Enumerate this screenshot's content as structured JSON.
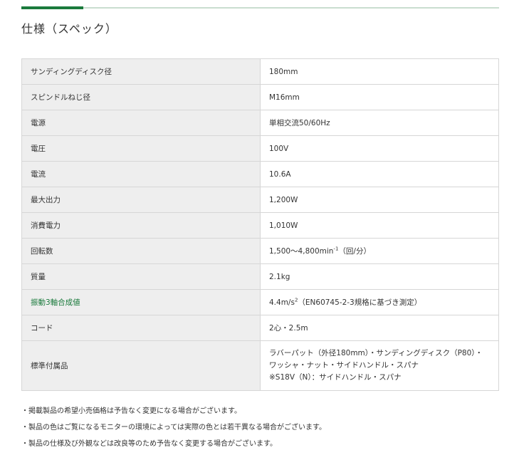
{
  "title": "仕様（スペック）",
  "spec_rows": [
    {
      "label": "サンディングディスク径",
      "value": "180mm"
    },
    {
      "label": "スピンドルねじ径",
      "value": "M16mm"
    },
    {
      "label": "電源",
      "value": "単相交流50/60Hz"
    },
    {
      "label": "電圧",
      "value": "100V"
    },
    {
      "label": "電流",
      "value": "10.6A"
    },
    {
      "label": "最大出力",
      "value": "1,200W"
    },
    {
      "label": "消費電力",
      "value": "1,010W"
    },
    {
      "label": "回転数",
      "value_main": "1,500～4,800min",
      "value_sup": "-1",
      "value_tail": "（回/分）"
    },
    {
      "label": "質量",
      "value": "2.1kg"
    },
    {
      "label": "振動3軸合成値",
      "value_main": "4.4m/s",
      "value_sup": "2",
      "value_tail": "（EN60745-2-3規格に基づき測定）"
    },
    {
      "label": "コード",
      "value": "2心・2.5m"
    },
    {
      "label": "標準付属品",
      "value_lines": [
        "ラバーパット（外径180mm）・サンディングディスク（P80）・",
        "ワッシャ・ナット・サイドハンドル・スパナ",
        "※S18V（N）：サイドハンドル・スパナ"
      ]
    }
  ],
  "notes": [
    "・掲載製品の希望小売価格は予告なく変更になる場合がございます。",
    "・製品の色はご覧になるモニターの環境によっては実際の色とは若干異なる場合がございます。",
    "・製品の仕様及び外観などは改良等のため予告なく変更する場合がございます。"
  ],
  "colors": {
    "accent": "#1a7a3c",
    "label_bg": "#eeeeee",
    "border": "#d6d6d6"
  }
}
